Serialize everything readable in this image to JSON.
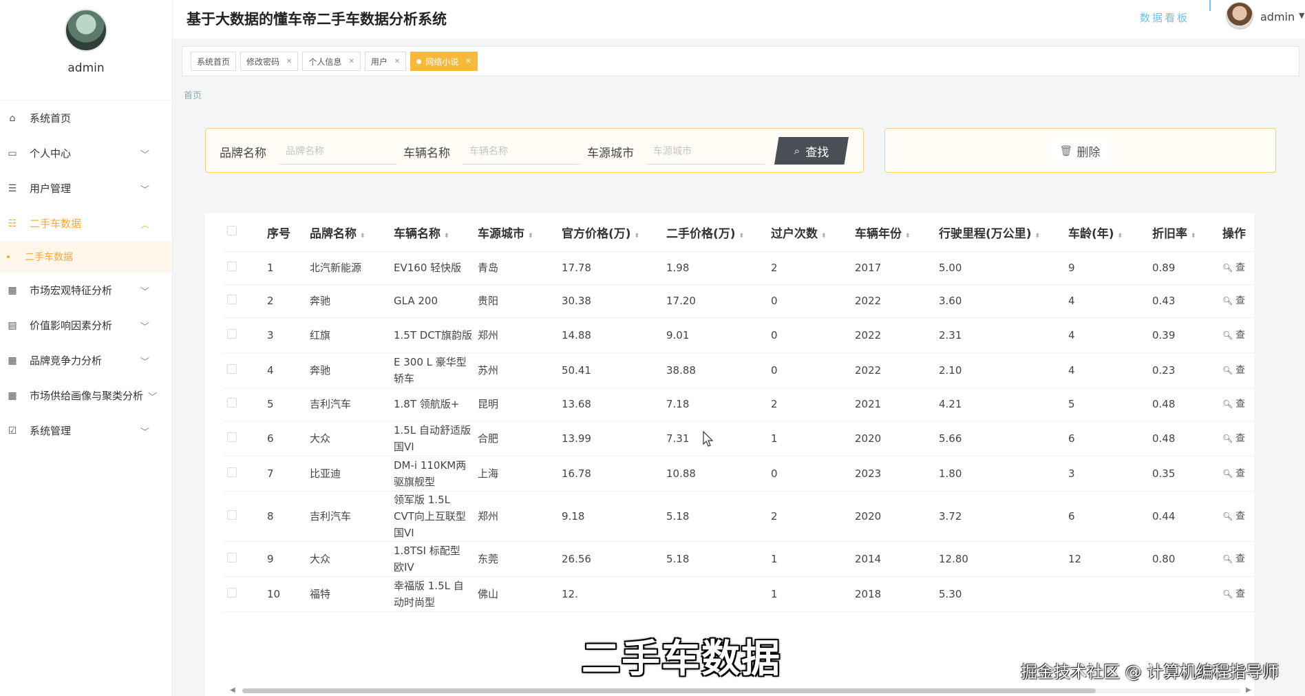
{
  "header": {
    "title": "基于大数据的懂车帝二手车数据分析系统",
    "dashboard_link": "数据看板",
    "username": "admin"
  },
  "sidebar": {
    "profile_name": "admin",
    "items": [
      {
        "label": "系统首页",
        "icon": "home-icon"
      },
      {
        "label": "个人中心",
        "icon": "id-card-icon"
      },
      {
        "label": "用户管理",
        "icon": "list-icon"
      },
      {
        "label": "二手车数据",
        "icon": "sliders-icon",
        "active": true
      },
      {
        "label": "市场宏观特征分析",
        "icon": "grid-icon"
      },
      {
        "label": "价值影响因素分析",
        "icon": "clipboard-icon"
      },
      {
        "label": "品牌竞争力分析",
        "icon": "grid-icon"
      },
      {
        "label": "市场供给画像与聚类分析",
        "icon": "grid-icon"
      },
      {
        "label": "系统管理",
        "icon": "checkbox-icon"
      }
    ],
    "sub_item": "二手车数据"
  },
  "tabs": [
    {
      "label": "系统首页",
      "closable": false
    },
    {
      "label": "修改密码",
      "closable": true
    },
    {
      "label": "个人信息",
      "closable": true
    },
    {
      "label": "用户",
      "closable": true
    },
    {
      "label": "网络小说",
      "closable": true,
      "active": true
    }
  ],
  "breadcrumb": "首页",
  "search": {
    "brand_label": "品牌名称",
    "brand_placeholder": "品牌名称",
    "vehicle_label": "车辆名称",
    "vehicle_placeholder": "车辆名称",
    "city_label": "车源城市",
    "city_placeholder": "车源城市",
    "search_button": "查找",
    "delete_button": "删除"
  },
  "table": {
    "columns": [
      "序号",
      "品牌名称",
      "车辆名称",
      "车源城市",
      "官方价格(万)",
      "二手价格(万)",
      "过户次数",
      "车辆年份",
      "行驶里程(万公里)",
      "车龄(年)",
      "折旧率",
      "操作"
    ],
    "op_label": "查",
    "rows": [
      [
        "1",
        "北汽新能源",
        "EV160 轻快版",
        "青岛",
        "17.78",
        "1.98",
        "2",
        "2017",
        "5.00",
        "9",
        "0.89"
      ],
      [
        "2",
        "奔驰",
        "GLA 200",
        "贵阳",
        "30.38",
        "17.20",
        "0",
        "2022",
        "3.60",
        "4",
        "0.43"
      ],
      [
        "3",
        "红旗",
        "1.5T DCT旗韵版",
        "郑州",
        "14.88",
        "9.01",
        "0",
        "2022",
        "2.31",
        "4",
        "0.39"
      ],
      [
        "4",
        "奔驰",
        "E 300 L 豪华型 轿车",
        "苏州",
        "50.41",
        "38.88",
        "0",
        "2022",
        "2.10",
        "4",
        "0.23"
      ],
      [
        "5",
        "吉利汽车",
        "1.8T 领航版+",
        "昆明",
        "13.68",
        "7.18",
        "2",
        "2021",
        "4.21",
        "5",
        "0.48"
      ],
      [
        "6",
        "大众",
        "1.5L 自动舒适版 国VI",
        "合肥",
        "13.99",
        "7.31",
        "1",
        "2020",
        "5.66",
        "6",
        "0.48"
      ],
      [
        "7",
        "比亚迪",
        "DM-i 110KM两驱旗舰型",
        "上海",
        "16.78",
        "10.88",
        "0",
        "2023",
        "1.80",
        "3",
        "0.35"
      ],
      [
        "8",
        "吉利汽车",
        "领军版 1.5L CVT向上互联型 国VI",
        "郑州",
        "9.18",
        "5.18",
        "2",
        "2020",
        "3.72",
        "6",
        "0.44"
      ],
      [
        "9",
        "大众",
        "1.8TSI 标配型 欧IV",
        "东莞",
        "26.56",
        "5.18",
        "1",
        "2014",
        "12.80",
        "12",
        "0.80"
      ],
      [
        "10",
        "福特",
        "幸福版 1.5L 自动时尚型",
        "佛山",
        "12.",
        "",
        "1",
        "2018",
        "5.30",
        "",
        ""
      ]
    ]
  },
  "overlay": {
    "caption": "二手车数据",
    "watermark": "掘金技术社区 @ 计算机编程指导师"
  },
  "colors": {
    "accent": "#f3a93c",
    "tab_active": "#f6b93b",
    "dashboard_link": "#6ec3e6",
    "search_button": "#4a4f55"
  }
}
